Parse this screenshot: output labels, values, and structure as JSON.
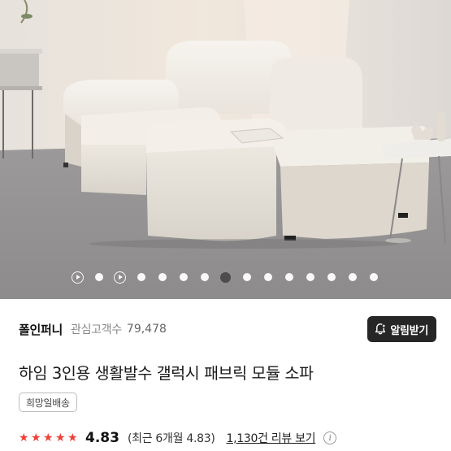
{
  "carousel": {
    "slides": [
      {
        "kind": "video",
        "active": false
      },
      {
        "kind": "image",
        "active": false
      },
      {
        "kind": "video",
        "active": false
      },
      {
        "kind": "image",
        "active": false
      },
      {
        "kind": "image",
        "active": false
      },
      {
        "kind": "image",
        "active": false
      },
      {
        "kind": "image",
        "active": false
      },
      {
        "kind": "image",
        "active": true
      },
      {
        "kind": "image",
        "active": false
      },
      {
        "kind": "image",
        "active": false
      },
      {
        "kind": "image",
        "active": false
      },
      {
        "kind": "image",
        "active": false
      },
      {
        "kind": "image",
        "active": false
      },
      {
        "kind": "image",
        "active": false
      },
      {
        "kind": "image",
        "active": false
      }
    ]
  },
  "brand": {
    "name": "폴인퍼니",
    "interest_label": "관심고객수",
    "interest_count": "79,478",
    "alarm_button_label": "알림받기"
  },
  "product": {
    "title": "하임 3인용 생활발수 갤럭시 패브릭 모듈 소파",
    "shipping_badge": "희망일배송"
  },
  "rating": {
    "stars": 5,
    "score": "4.83",
    "recent_text": "(최근 6개월 4.83)",
    "review_link": "1,130건 리뷰 보기",
    "info_icon": "i"
  },
  "colors": {
    "star": "#ef3e36",
    "alarm_button_bg": "#262626"
  }
}
